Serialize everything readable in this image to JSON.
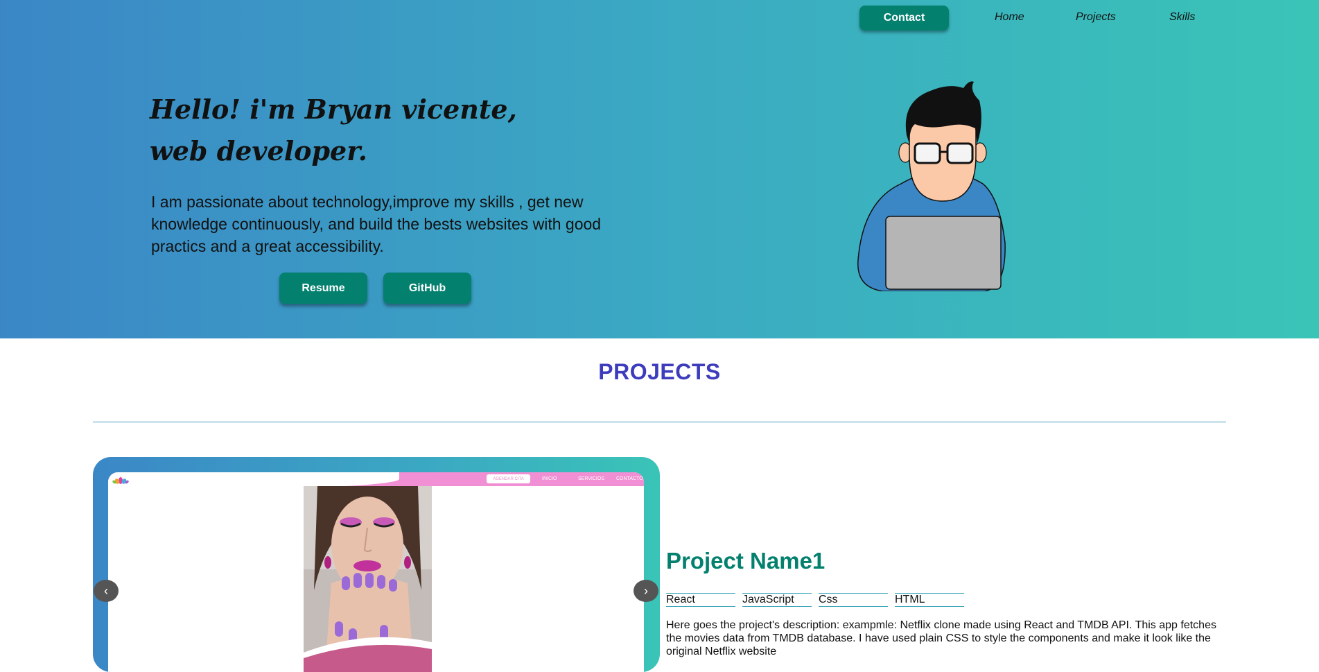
{
  "nav": {
    "contact": "Contact",
    "home": "Home",
    "projects": "Projects",
    "skills": "Skills"
  },
  "hero": {
    "title": "Hello! i'm Bryan vicente, web developer.",
    "description": "I am passionate about technology,improve my skills , get new knowledge continuously, and build the bests websites with good practics and a great accessibility.",
    "resume_button": "Resume",
    "github_button": "GitHub",
    "illustration_icon": "developer-with-laptop-icon"
  },
  "projects": {
    "section_title": "PROJECTS",
    "carousel": {
      "screenshot_header": {
        "button": "AGENDAR CITA",
        "links": [
          "INICIO",
          "SERVICIOS",
          "CONTACTO"
        ]
      },
      "prev_icon": "chevron-left-icon",
      "next_icon": "chevron-right-icon"
    },
    "item": {
      "name": "Project Name1",
      "tags": [
        "React",
        "JavaScript",
        "Css",
        "HTML"
      ],
      "description": "Here goes the project's description: exampmle: Netflix clone made using React and TMDB API. This app fetches the movies data from TMDB database. I have used plain CSS to style the components and make it look like the original Netflix website"
    }
  },
  "colors": {
    "gradient_start": "#3b87c6",
    "gradient_end": "#3ac4b7",
    "button": "#04806f",
    "projects_title": "#3d3cbd",
    "project_name": "#04806f"
  }
}
